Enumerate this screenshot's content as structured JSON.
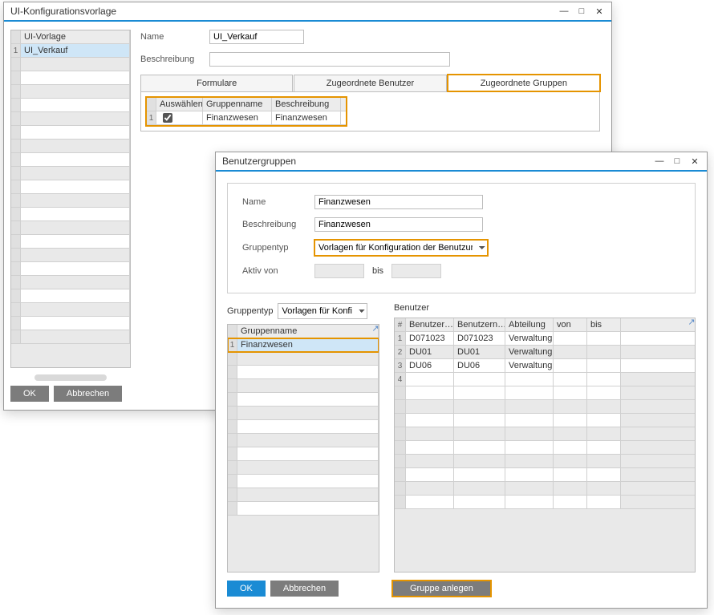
{
  "w1": {
    "title": "UI-Konfigurationsvorlage",
    "grid_header": "UI-Vorlage",
    "grid_rows": [
      {
        "n": "1",
        "name": "UI_Verkauf"
      }
    ],
    "ok": "OK",
    "cancel": "Abbrechen",
    "name_lbl": "Name",
    "name_val": "UI_Verkauf",
    "desc_lbl": "Beschreibung",
    "desc_val": "",
    "tabs": [
      "Formulare",
      "Zugeordnete Benutzer",
      "Zugeordnete Gruppen"
    ],
    "group_grid": {
      "headers": [
        "Auswählen",
        "Gruppenname",
        "Beschreibung"
      ],
      "row": {
        "n": "1",
        "checked": true,
        "name": "Finanzwesen",
        "desc": "Finanzwesen"
      }
    }
  },
  "w2": {
    "title": "Benutzergruppen",
    "form": {
      "name_lbl": "Name",
      "name_val": "Finanzwesen",
      "desc_lbl": "Beschreibung",
      "desc_val": "Finanzwesen",
      "type_lbl": "Gruppentyp",
      "type_val": "Vorlagen für Konfiguration der Benutzur",
      "active_lbl": "Aktiv von",
      "bis_lbl": "bis"
    },
    "left": {
      "type_lbl": "Gruppentyp",
      "type_val": "Vorlagen für Konfig",
      "gn_header": "Gruppenname",
      "rows": [
        {
          "n": "1",
          "name": "Finanzwesen"
        }
      ]
    },
    "right": {
      "title": "Benutzer",
      "headers": [
        "#",
        "Benutzer…",
        "Benutzern…",
        "Abteilung",
        "von",
        "bis"
      ],
      "rows": [
        {
          "n": "1",
          "a": "D071023",
          "b": "D071023",
          "c": "Verwaltung"
        },
        {
          "n": "2",
          "a": "DU01",
          "b": "DU01",
          "c": "Verwaltung"
        },
        {
          "n": "3",
          "a": "DU06",
          "b": "DU06",
          "c": "Verwaltung"
        },
        {
          "n": "4",
          "a": "",
          "b": "",
          "c": ""
        }
      ]
    },
    "ok": "OK",
    "cancel": "Abbrechen",
    "create": "Gruppe anlegen"
  }
}
